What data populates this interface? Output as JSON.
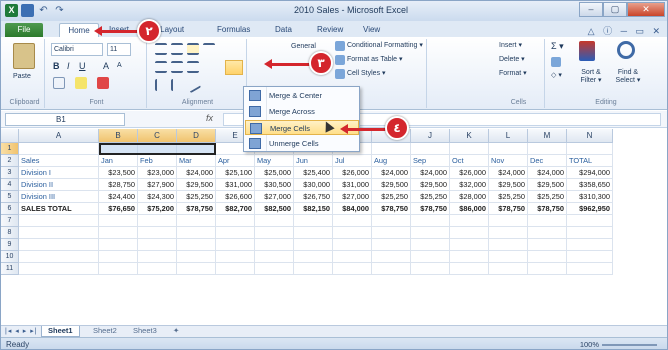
{
  "window": {
    "title": "2010 Sales - Microsoft Excel",
    "app_icon": "X",
    "controls": [
      "–",
      "▢",
      "✕"
    ],
    "help_icons": "△ ⓘ ─ ▭ ✕"
  },
  "tabs": {
    "file": "File",
    "home": "Home",
    "insert": "Insert",
    "page_layout": "ge Layout",
    "formulas": "Formulas",
    "data": "Data",
    "review": "Review",
    "view": "View"
  },
  "ribbon": {
    "clipboard": {
      "label": "Clipboard",
      "paste": "Paste"
    },
    "font": {
      "label": "Font",
      "font_name": "Calibri",
      "font_size": "11"
    },
    "alignment": {
      "label": "Alignment"
    },
    "number": {
      "format": "General"
    },
    "styles": {
      "conditional": "Conditional Formatting ▾",
      "format_table": "Format as Table ▾",
      "cell_styles": "Cell Styles ▾"
    },
    "cells": {
      "label": "Cells",
      "insert": "Insert ▾",
      "delete": "Delete ▾",
      "format": "Format ▾"
    },
    "editing": {
      "label": "Editing",
      "sort": "Sort & Filter ▾",
      "find": "Find & Select ▾"
    }
  },
  "formula_bar": {
    "name_box": "B1",
    "fx": "fx"
  },
  "merge_menu": {
    "items": [
      "Merge & Center",
      "Merge Across",
      "Merge Cells",
      "Unmerge Cells"
    ],
    "highlighted": "Merge Cells"
  },
  "grid": {
    "columns": [
      "A",
      "B",
      "C",
      "D",
      "E",
      "F",
      "G",
      "H",
      "I",
      "J",
      "K",
      "L",
      "M",
      "N"
    ],
    "rows": [
      "1",
      "2",
      "3",
      "4",
      "5",
      "6",
      "7",
      "8",
      "9",
      "10",
      "11"
    ],
    "header": [
      "Sales",
      "Jan",
      "Feb",
      "Mar",
      "Apr",
      "May",
      "Jun",
      "Jul",
      "Aug",
      "Sep",
      "Oct",
      "Nov",
      "Dec",
      "TOTAL"
    ],
    "data": [
      [
        "Division I",
        "$23,500",
        "$23,000",
        "$24,000",
        "$25,100",
        "$25,000",
        "$25,400",
        "$26,000",
        "$24,000",
        "$24,000",
        "$26,000",
        "$24,000",
        "$24,000",
        "$294,000"
      ],
      [
        "Division II",
        "$28,750",
        "$27,900",
        "$29,500",
        "$31,000",
        "$30,500",
        "$30,000",
        "$31,000",
        "$29,500",
        "$29,500",
        "$32,000",
        "$29,500",
        "$29,500",
        "$358,650"
      ],
      [
        "Division III",
        "$24,400",
        "$24,300",
        "$25,250",
        "$26,600",
        "$27,000",
        "$26,750",
        "$27,000",
        "$25,250",
        "$25,250",
        "$28,000",
        "$25,250",
        "$25,250",
        "$310,300"
      ],
      [
        "SALES TOTAL",
        "$76,650",
        "$75,200",
        "$78,750",
        "$82,700",
        "$82,500",
        "$82,150",
        "$84,000",
        "$78,750",
        "$78,750",
        "$86,000",
        "$78,750",
        "$78,750",
        "$962,950"
      ]
    ]
  },
  "sheets": {
    "tabs": [
      "Sheet1",
      "Sheet2",
      "Sheet3"
    ],
    "active": "Sheet1"
  },
  "status": {
    "text": "Ready",
    "zoom": "100%"
  },
  "callouts": [
    "٢",
    "٣",
    "٤"
  ],
  "colors": {
    "accent": "#d4262d",
    "file_tab": "#2c7a2c",
    "header_text": "#4a7fc1"
  }
}
